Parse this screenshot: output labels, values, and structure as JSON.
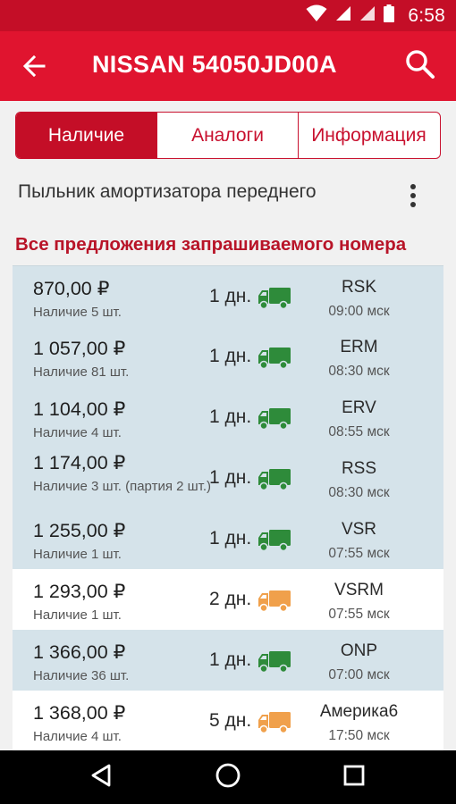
{
  "status_bar": {
    "time": "6:58",
    "icons": [
      "wifi-icon",
      "signal-icon",
      "signal-icon",
      "battery-icon"
    ]
  },
  "app_bar": {
    "title": "NISSAN 54050JD00A",
    "back_icon": "arrow-left-icon",
    "search_icon": "search-icon",
    "background": "#e0142f"
  },
  "tabs": [
    {
      "label": "Наличие",
      "active": true
    },
    {
      "label": "Аналоги",
      "active": false
    },
    {
      "label": "Информация",
      "active": false
    }
  ],
  "description": {
    "text": "Пыльник амортизатора переднего",
    "menu_icon": "more-vertical-icon"
  },
  "section_title": "Все предложения запрашиваемого номера",
  "colors": {
    "accent": "#c8102e",
    "in_stock_row": "#d5e3ea",
    "truck_green": "#2e8b3a",
    "truck_orange": "#f0a04b"
  },
  "offers": [
    {
      "price": "870,00 ₽",
      "stock": "Наличие 5 шт.",
      "delivery": "1 дн.",
      "truck": "green",
      "supplier": "RSK",
      "time": "09:00 мск",
      "highlight": true
    },
    {
      "price": "1 057,00 ₽",
      "stock": "Наличие 81 шт.",
      "delivery": "1 дн.",
      "truck": "green",
      "supplier": "ERM",
      "time": "08:30 мск",
      "highlight": true
    },
    {
      "price": "1 104,00 ₽",
      "stock": "Наличие 4 шт.",
      "delivery": "1 дн.",
      "truck": "green",
      "supplier": "ERV",
      "time": "08:55 мск",
      "highlight": true
    },
    {
      "price": "1 174,00 ₽",
      "stock": "Наличие 3 шт. (партия 2 шт.)",
      "delivery": "1 дн.",
      "truck": "green",
      "supplier": "RSS",
      "time": "08:30 мск",
      "highlight": true
    },
    {
      "price": "1 255,00 ₽",
      "stock": "Наличие 1 шт.",
      "delivery": "1 дн.",
      "truck": "green",
      "supplier": "VSR",
      "time": "07:55 мск",
      "highlight": true
    },
    {
      "price": "1 293,00 ₽",
      "stock": "Наличие 1 шт.",
      "delivery": "2 дн.",
      "truck": "orange",
      "supplier": "VSRM",
      "time": "07:55 мск",
      "highlight": false
    },
    {
      "price": "1 366,00 ₽",
      "stock": "Наличие 36 шт.",
      "delivery": "1 дн.",
      "truck": "green",
      "supplier": "ONP",
      "time": "07:00 мск",
      "highlight": true
    },
    {
      "price": "1 368,00 ₽",
      "stock": "Наличие 4 шт.",
      "delivery": "5 дн.",
      "truck": "orange",
      "supplier": "Америка6",
      "time": "17:50 мск",
      "highlight": false
    }
  ],
  "nav_bar": {
    "icons": [
      "back-triangle-icon",
      "home-circle-icon",
      "recents-square-icon"
    ]
  }
}
